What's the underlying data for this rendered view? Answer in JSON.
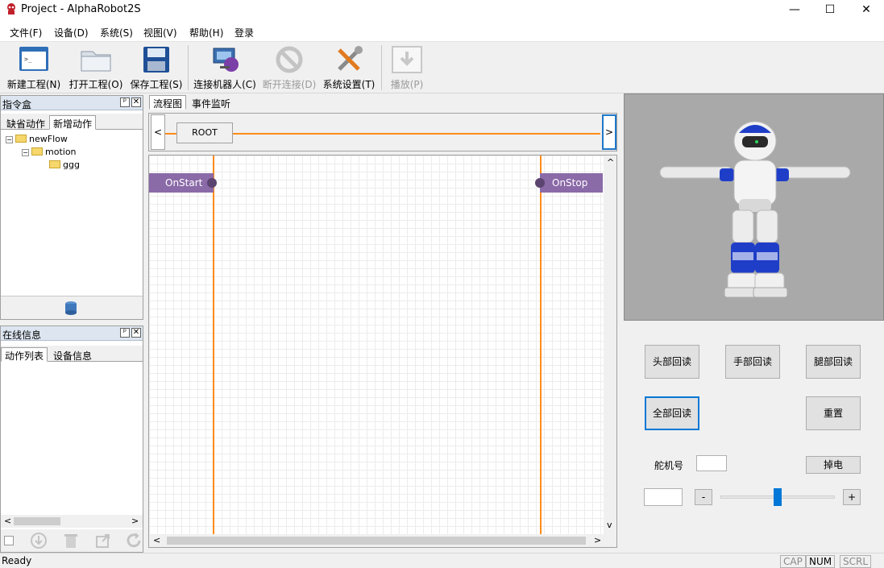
{
  "window": {
    "title": "Project - AlphaRobot2S",
    "minimize": "—",
    "maximize": "☐",
    "close": "✕"
  },
  "menu": [
    "文件(F)",
    "设备(D)",
    "系统(S)",
    "视图(V)",
    "帮助(H)",
    "登录"
  ],
  "toolbar": {
    "new_project": "新建工程(N)",
    "open_project": "打开工程(O)",
    "save_project": "保存工程(S)",
    "connect_robot": "连接机器人(C)",
    "disconnect": "断开连接(D)",
    "system_settings": "系统设置(T)",
    "play": "播放(P)"
  },
  "command_box": {
    "title": "指令盒",
    "pin": "ᵖ",
    "close": "✕",
    "tabs": [
      "缺省动作",
      "新增动作"
    ],
    "tree": [
      "newFlow",
      "motion",
      "ggg"
    ],
    "toggle_minus": "−"
  },
  "online_info": {
    "title": "在线信息",
    "pin": "ᵖ",
    "close": "✕",
    "tabs": [
      "动作列表",
      "设备信息"
    ]
  },
  "center": {
    "tabs": [
      "流程图",
      "事件监听"
    ],
    "root_label": "ROOT",
    "nav_left": "<",
    "nav_right": ">",
    "nodes": {
      "start": "OnStart",
      "stop": "OnStop"
    },
    "scroll_left": "<",
    "scroll_right": ">",
    "scroll_up": "^",
    "scroll_down": "v"
  },
  "controls": {
    "head_readback": "头部回读",
    "hand_readback": "手部回读",
    "leg_readback": "腿部回读",
    "all_readback": "全部回读",
    "reset": "重置",
    "servo_label": "舵机号",
    "power_off": "掉电",
    "minus": "-",
    "plus": "+",
    "slider_position": 0.5
  },
  "status": {
    "text": "Ready",
    "cap": "CAP",
    "num": "NUM",
    "scrl": "SCRL"
  },
  "colors": {
    "flow_line": "#ff8c1a",
    "node": "#8b6aa8",
    "accent": "#0078d7",
    "robot_blue": "#1f3ec8"
  }
}
